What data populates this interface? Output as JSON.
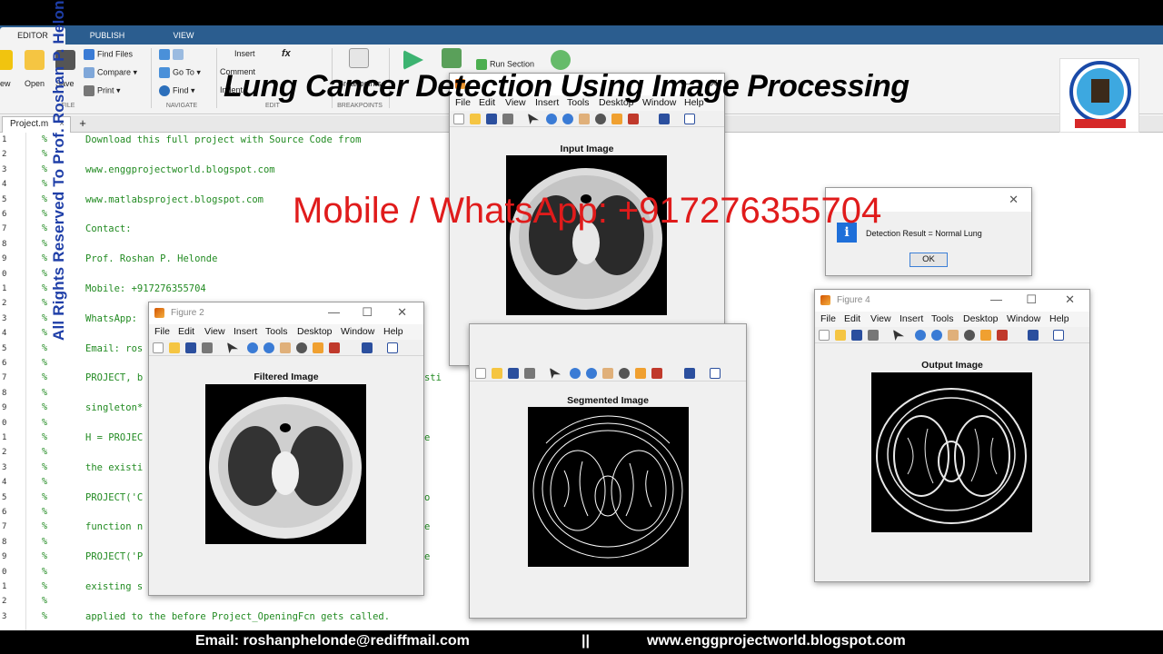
{
  "ribbon": {
    "tabs": [
      "EDITOR",
      "PUBLISH",
      "VIEW"
    ],
    "buttons": {
      "new": "ew",
      "open": "Open",
      "save": "Save",
      "find_files": "Find Files",
      "compare": "Compare",
      "print": "Print",
      "go_to": "Go To",
      "find": "Find",
      "insert": "Insert",
      "fx": "fx",
      "comment": "Comment",
      "indent": "Indent",
      "breakpoints": "Breakpoints",
      "run_section": "Run Section"
    },
    "groups": [
      "FILE",
      "NAVIGATE",
      "EDIT",
      "BREAKPOINTS"
    ]
  },
  "editor": {
    "file_tab": "Project.m",
    "code_lines": [
      {
        "num": "1",
        "text": "Download this full project with Source Code from"
      },
      {
        "num": "2",
        "text": ""
      },
      {
        "num": "3",
        "text": "www.enggprojectworld.blogspot.com"
      },
      {
        "num": "4",
        "text": ""
      },
      {
        "num": "5",
        "text": "www.matlabsproject.blogspot.com"
      },
      {
        "num": "6",
        "text": ""
      },
      {
        "num": "7",
        "text": "Contact:"
      },
      {
        "num": "8",
        "text": ""
      },
      {
        "num": "9",
        "text": "Prof. Roshan P. Helonde"
      },
      {
        "num": "0",
        "text": ""
      },
      {
        "num": "1",
        "text": "Mobile: +917276355704"
      },
      {
        "num": "2",
        "text": ""
      },
      {
        "num": "3",
        "text": "WhatsApp:"
      },
      {
        "num": "4",
        "text": ""
      },
      {
        "num": "5",
        "text": "Email: ros"
      },
      {
        "num": "6",
        "text": ""
      },
      {
        "num": "7",
        "text": "PROJECT, b                                            e existi"
      },
      {
        "num": "8",
        "text": ""
      },
      {
        "num": "9",
        "text": "singleton*"
      },
      {
        "num": "0",
        "text": ""
      },
      {
        "num": "1",
        "text": "H = PROJEC                                            handle "
      },
      {
        "num": "2",
        "text": ""
      },
      {
        "num": "3",
        "text": "the existi"
      },
      {
        "num": "4",
        "text": ""
      },
      {
        "num": "5",
        "text": "PROJECT('C                                          s the lo"
      },
      {
        "num": "6",
        "text": ""
      },
      {
        "num": "7",
        "text": "function n                                          t argume"
      },
      {
        "num": "8",
        "text": ""
      },
      {
        "num": "9",
        "text": "PROJECT('P                                          or raise"
      },
      {
        "num": "0",
        "text": ""
      },
      {
        "num": "1",
        "text": "existing s                                          value p"
      },
      {
        "num": "2",
        "text": ""
      },
      {
        "num": "3",
        "text": "applied to the before Project_OpeningFcn gets called."
      }
    ]
  },
  "overlay": {
    "title": "Lung Cancer Detection Using Image Processing",
    "mobile": "Mobile / WhatsApp: +917276355704",
    "rights": "All Rights Reserved To Prof. Roshan P. Helonde",
    "email": "Email: roshanphelonde@rediffmail.com",
    "divider": "||",
    "website": "www.enggprojectworld.blogspot.com"
  },
  "figure_menu": [
    "File",
    "Edit",
    "View",
    "Insert",
    "Tools",
    "Desktop",
    "Window",
    "Help"
  ],
  "figures": {
    "input": {
      "axes_title": "Input Image"
    },
    "filtered": {
      "window_title": "Figure 2",
      "axes_title": "Filtered Image"
    },
    "segmented": {
      "axes_title": "Segmented Image"
    },
    "output": {
      "window_title": "Figure 4",
      "axes_title": "Output Image"
    }
  },
  "dialog": {
    "message": "Detection Result = Normal Lung",
    "ok_label": "OK"
  },
  "colors": {
    "title_red": "#e01b1b",
    "rights_blue": "#1f3fa8",
    "comment_green": "#228b22",
    "ribbon_tab_blue": "#2b5d8f"
  }
}
